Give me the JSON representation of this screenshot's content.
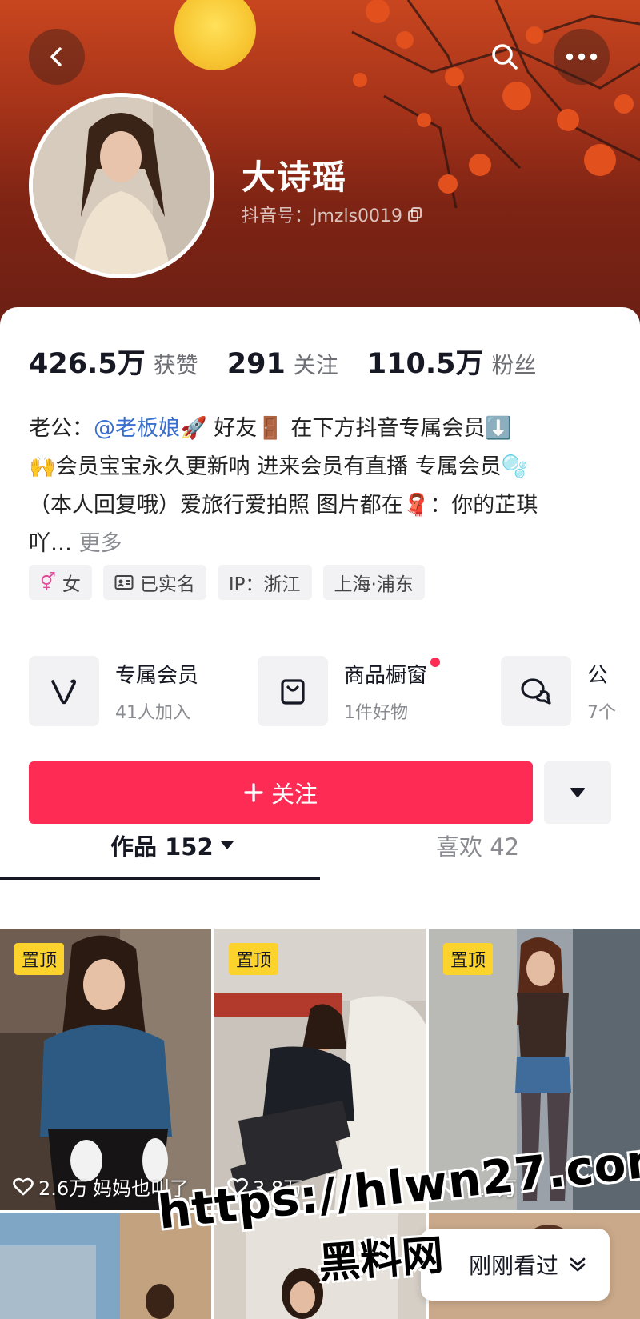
{
  "header": {
    "profile_name": "大诗瑶",
    "douyin_id": "抖音号：Jmzls0019"
  },
  "stats": [
    {
      "value": "426.5万",
      "label": "获赞"
    },
    {
      "value": "291",
      "label": "关注"
    },
    {
      "value": "110.5万",
      "label": "粉丝"
    }
  ],
  "bio": {
    "line1_prefix": "老公：",
    "mention": "@老板娘",
    "line1_rest": "🚀 好友🚪 在下方抖音专属会员⬇️",
    "line2": "🙌会员宝宝永久更新呐 进来会员有直播  专属会员🫧",
    "line3": "（本人回复哦）爱旅行爱拍照 图片都在🧣：你的芷琪",
    "line4": "吖…",
    "more": "更多"
  },
  "tags": [
    "女",
    "已实名",
    "IP：浙江",
    "上海·浦东"
  ],
  "services": [
    {
      "title": "专属会员",
      "subtitle": "41人加入",
      "icon": "vip-v-icon"
    },
    {
      "title": "商品橱窗",
      "subtitle": "1件好物",
      "icon": "shop-bag-icon"
    },
    {
      "title": "公",
      "subtitle": "7个",
      "icon": "chat-bubbles-icon"
    }
  ],
  "follow_button": {
    "label": "关注",
    "icon": "plus-icon"
  },
  "tabs": [
    {
      "label": "作品 152",
      "active": true
    },
    {
      "label": "喜欢 42",
      "active": false
    }
  ],
  "videos": [
    {
      "pinned": "置顶",
      "likes": "2.6万",
      "caption": "妈妈也叫了"
    },
    {
      "pinned": "置顶",
      "likes": "3.8万",
      "caption": ""
    },
    {
      "pinned": "置顶",
      "likes": "3.8万",
      "caption": ""
    }
  ],
  "overlay": {
    "watermark": "https://hlwn27.com",
    "watermark_sub": "黑料网",
    "recent_label": "刚刚看过"
  },
  "colors": {
    "brand_red": "#fe2c55",
    "pin_yellow": "#fcd32d",
    "mention_blue": "#3a6fd0"
  }
}
